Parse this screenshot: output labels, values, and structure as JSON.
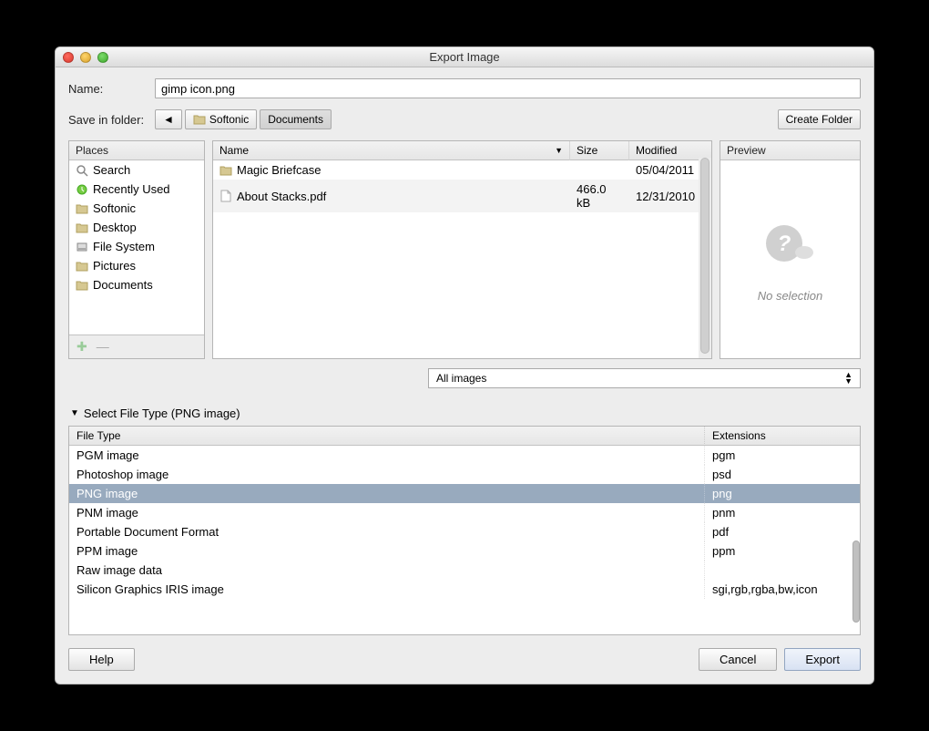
{
  "window": {
    "title": "Export Image"
  },
  "name_row": {
    "label": "Name:",
    "value": "gimp icon.png"
  },
  "folder_row": {
    "label": "Save in folder:",
    "path": [
      "Softonic",
      "Documents"
    ],
    "selected_index": 1,
    "create_folder": "Create Folder"
  },
  "places": {
    "header": "Places",
    "items": [
      {
        "label": "Search",
        "icon": "search"
      },
      {
        "label": "Recently Used",
        "icon": "recent"
      },
      {
        "label": "Softonic",
        "icon": "folder"
      },
      {
        "label": "Desktop",
        "icon": "folder"
      },
      {
        "label": "File System",
        "icon": "disk"
      },
      {
        "label": "Pictures",
        "icon": "folder"
      },
      {
        "label": "Documents",
        "icon": "folder"
      }
    ]
  },
  "file_columns": {
    "name": "Name",
    "size": "Size",
    "modified": "Modified"
  },
  "files": [
    {
      "name": "Magic Briefcase",
      "icon": "folder",
      "size": "",
      "modified": "05/04/2011"
    },
    {
      "name": "About Stacks.pdf",
      "icon": "file",
      "size": "466.0 kB",
      "modified": "12/31/2010"
    }
  ],
  "preview": {
    "header": "Preview",
    "noselection": "No selection"
  },
  "filter": {
    "selected": "All images"
  },
  "expander": {
    "label": "Select File Type (PNG image)"
  },
  "filetype_columns": {
    "type": "File Type",
    "ext": "Extensions"
  },
  "filetypes": [
    {
      "type": "PGM image",
      "ext": "pgm",
      "selected": false
    },
    {
      "type": "Photoshop image",
      "ext": "psd",
      "selected": false
    },
    {
      "type": "PNG image",
      "ext": "png",
      "selected": true
    },
    {
      "type": "PNM image",
      "ext": "pnm",
      "selected": false
    },
    {
      "type": "Portable Document Format",
      "ext": "pdf",
      "selected": false
    },
    {
      "type": "PPM image",
      "ext": "ppm",
      "selected": false
    },
    {
      "type": "Raw image data",
      "ext": "",
      "selected": false
    },
    {
      "type": "Silicon Graphics IRIS image",
      "ext": "sgi,rgb,rgba,bw,icon",
      "selected": false
    }
  ],
  "footer": {
    "help": "Help",
    "cancel": "Cancel",
    "export": "Export"
  }
}
